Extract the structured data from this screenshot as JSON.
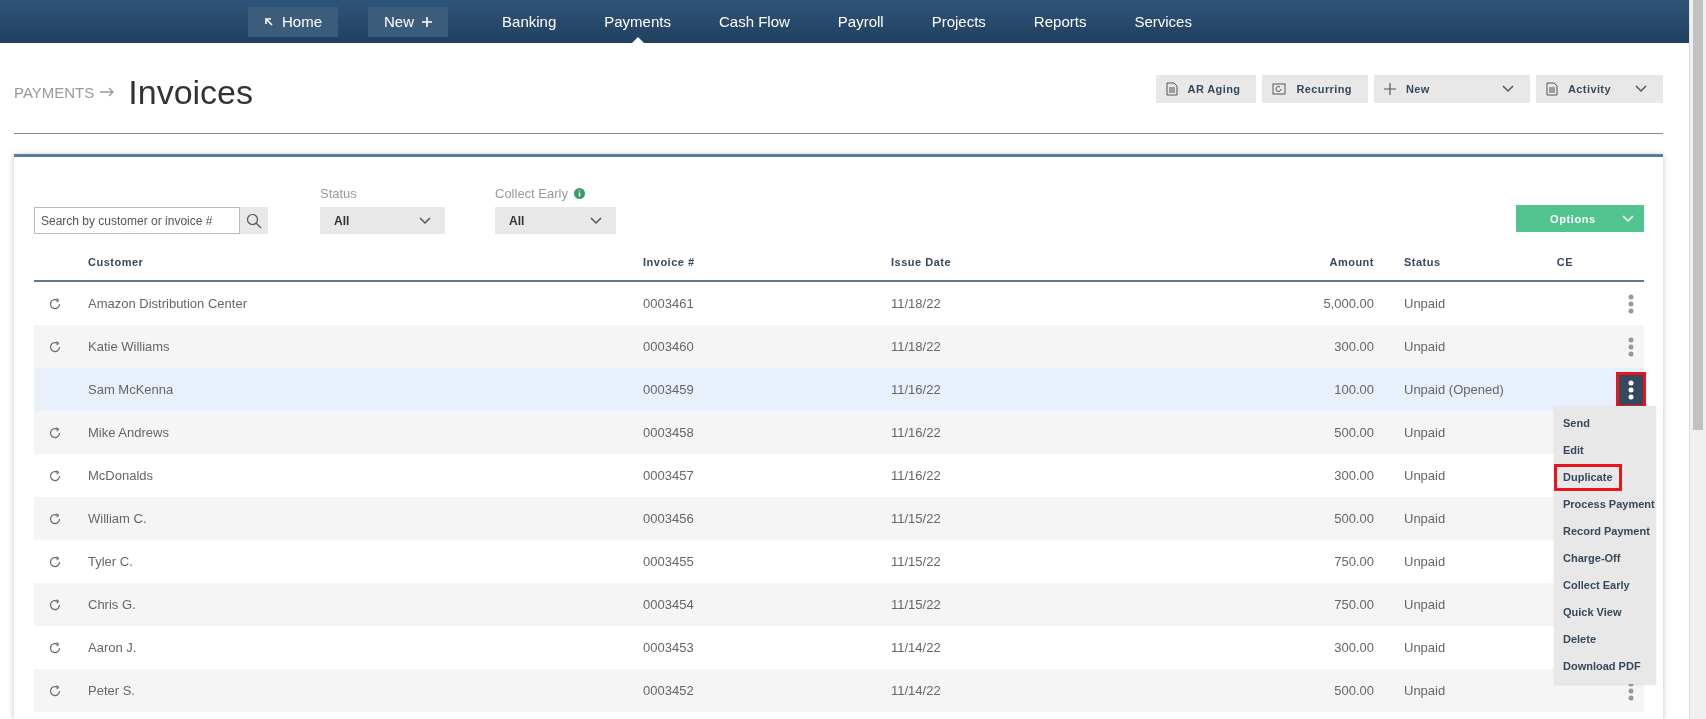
{
  "nav": {
    "items": [
      {
        "label": "Home",
        "kind": "button"
      },
      {
        "label": "New",
        "kind": "button"
      },
      {
        "label": "Banking",
        "kind": "link",
        "selected": false
      },
      {
        "label": "Payments",
        "kind": "link",
        "selected": true
      },
      {
        "label": "Cash Flow",
        "kind": "link",
        "selected": false
      },
      {
        "label": "Payroll",
        "kind": "link",
        "selected": false
      },
      {
        "label": "Projects",
        "kind": "link",
        "selected": false
      },
      {
        "label": "Reports",
        "kind": "link",
        "selected": false
      },
      {
        "label": "Services",
        "kind": "link",
        "selected": false
      }
    ]
  },
  "header": {
    "breadcrumb": "PAYMENTS",
    "title": "Invoices",
    "actions": [
      {
        "label": "AR Aging",
        "kind": "report",
        "dropdown": false
      },
      {
        "label": "Recurring",
        "kind": "recurring",
        "dropdown": false
      },
      {
        "label": "New",
        "kind": "new",
        "dropdown": true
      },
      {
        "label": "Activity",
        "kind": "report",
        "dropdown": true
      }
    ]
  },
  "filters": {
    "search": {
      "placeholder": "Search by customer or invoice #"
    },
    "selects": [
      {
        "label": "Status",
        "value": "All",
        "info": false
      },
      {
        "label": "Collect Early",
        "value": "All",
        "info": true
      }
    ],
    "options_button": "Options"
  },
  "table": {
    "columns": [
      "Customer",
      "Invoice #",
      "Issue Date",
      "Amount",
      "Status",
      "CE"
    ],
    "rows": [
      {
        "recurring": true,
        "customer": "Amazon Distribution Center",
        "invoice": "0003461",
        "date": "11/18/22",
        "amount": "5,000.00",
        "status": "Unpaid",
        "selected": false,
        "actions_visible": true,
        "menu_open": false
      },
      {
        "recurring": true,
        "customer": "Katie Williams",
        "invoice": "0003460",
        "date": "11/18/22",
        "amount": "300.00",
        "status": "Unpaid",
        "selected": false,
        "actions_visible": true,
        "menu_open": false
      },
      {
        "recurring": false,
        "customer": "Sam McKenna",
        "invoice": "0003459",
        "date": "11/16/22",
        "amount": "100.00",
        "status": "Unpaid (Opened)",
        "selected": true,
        "actions_visible": true,
        "menu_open": true
      },
      {
        "recurring": true,
        "customer": "Mike Andrews",
        "invoice": "0003458",
        "date": "11/16/22",
        "amount": "500.00",
        "status": "Unpaid",
        "selected": false,
        "actions_visible": false,
        "menu_open": false
      },
      {
        "recurring": true,
        "customer": "McDonalds",
        "invoice": "0003457",
        "date": "11/16/22",
        "amount": "300.00",
        "status": "Unpaid",
        "selected": false,
        "actions_visible": false,
        "menu_open": false
      },
      {
        "recurring": true,
        "customer": "William C.",
        "invoice": "0003456",
        "date": "11/15/22",
        "amount": "500.00",
        "status": "Unpaid",
        "selected": false,
        "actions_visible": false,
        "menu_open": false
      },
      {
        "recurring": true,
        "customer": "Tyler C.",
        "invoice": "0003455",
        "date": "11/15/22",
        "amount": "750.00",
        "status": "Unpaid",
        "selected": false,
        "actions_visible": false,
        "menu_open": false
      },
      {
        "recurring": true,
        "customer": "Chris G.",
        "invoice": "0003454",
        "date": "11/15/22",
        "amount": "750.00",
        "status": "Unpaid",
        "selected": false,
        "actions_visible": false,
        "menu_open": false
      },
      {
        "recurring": true,
        "customer": "Aaron J.",
        "invoice": "0003453",
        "date": "11/14/22",
        "amount": "300.00",
        "status": "Unpaid",
        "selected": false,
        "actions_visible": false,
        "menu_open": false
      },
      {
        "recurring": true,
        "customer": "Peter S.",
        "invoice": "0003452",
        "date": "11/14/22",
        "amount": "500.00",
        "status": "Unpaid",
        "selected": false,
        "actions_visible": true,
        "menu_open": false
      }
    ]
  },
  "row_menu": {
    "items": [
      {
        "label": "Send",
        "highlighted": false
      },
      {
        "label": "Edit",
        "highlighted": false
      },
      {
        "label": "Duplicate",
        "highlighted": true
      },
      {
        "label": "Process Payment",
        "highlighted": false
      },
      {
        "label": "Record Payment",
        "highlighted": false
      },
      {
        "label": "Charge-Off",
        "highlighted": false
      },
      {
        "label": "Collect Early",
        "highlighted": false
      },
      {
        "label": "Quick View",
        "highlighted": false
      },
      {
        "label": "Delete",
        "highlighted": false
      },
      {
        "label": "Download PDF",
        "highlighted": false
      }
    ]
  }
}
